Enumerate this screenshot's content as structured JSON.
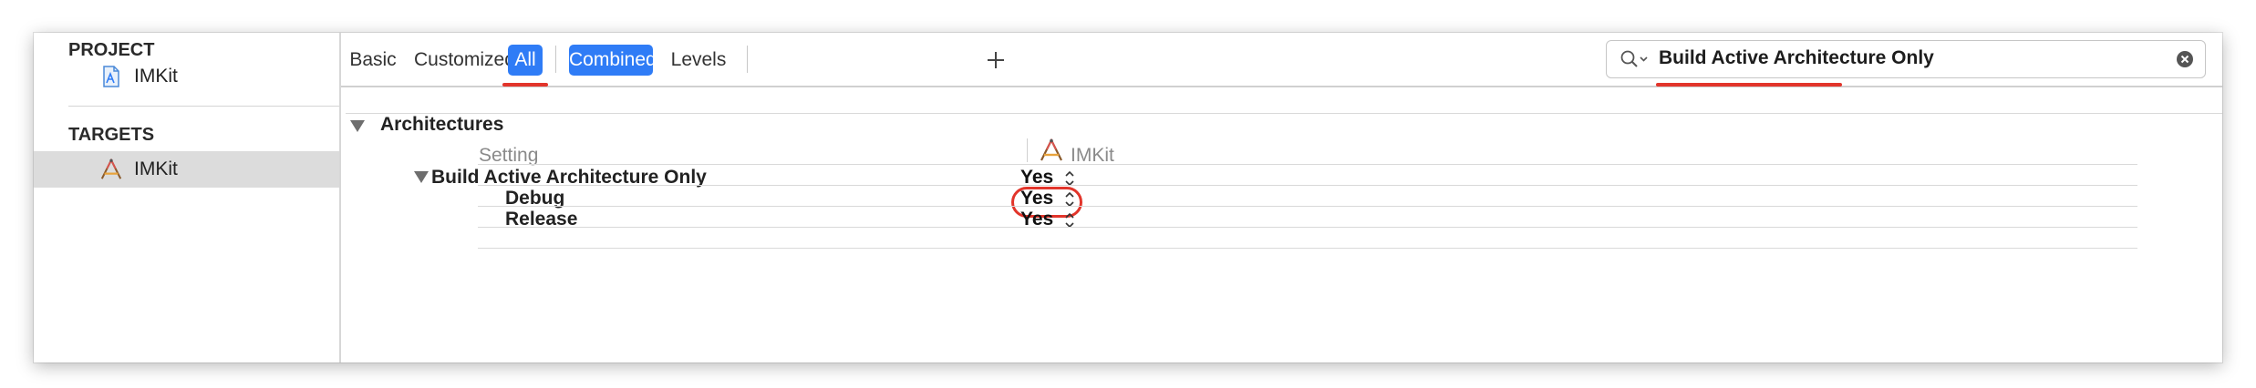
{
  "sidebar": {
    "project_header": "PROJECT",
    "project_item": "IMKit",
    "targets_header": "TARGETS",
    "target_item": "IMKit"
  },
  "toolbar": {
    "tabs": [
      "Basic",
      "Customized",
      "All"
    ],
    "view_modes": [
      "Combined",
      "Levels"
    ],
    "active_tab": "All",
    "active_view": "Combined",
    "add_icon": "plus-icon"
  },
  "search": {
    "value": "Build Active Architecture Only",
    "search_icon": "magnifier-icon",
    "clear_icon": "clear-icon"
  },
  "settings": {
    "group_title": "Architectures",
    "column_setting": "Setting",
    "column_target": "IMKit",
    "rows": [
      {
        "label": "Build Active Architecture Only",
        "value": "Yes"
      },
      {
        "label": "Debug",
        "value": "Yes"
      },
      {
        "label": "Release",
        "value": "Yes"
      }
    ]
  },
  "colors": {
    "accent": "#2f7cf6",
    "annotation": "#e2352b"
  }
}
